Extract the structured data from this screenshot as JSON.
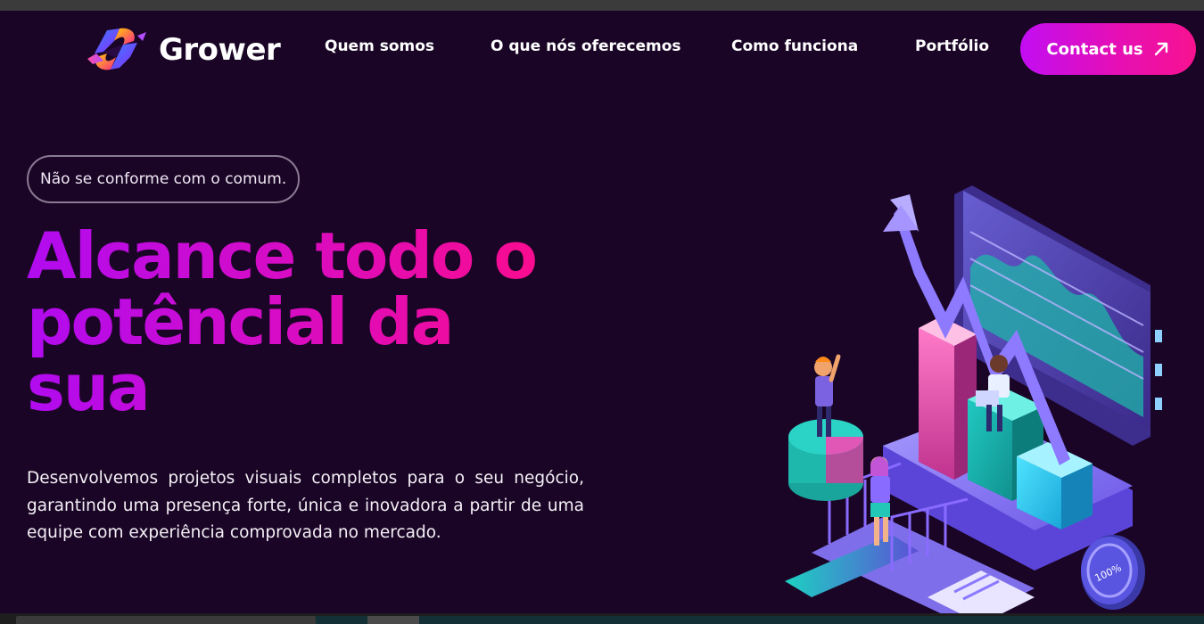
{
  "brand": {
    "name": "Grower",
    "logo_icon": "ribbon-s-logo-icon",
    "colors": {
      "background": "#1a0526",
      "accent_start": "#c20df2",
      "accent_end": "#f81290"
    }
  },
  "nav": {
    "items": [
      {
        "label": "Quem somos"
      },
      {
        "label": "O que nós oferecemos"
      },
      {
        "label": "Como funciona"
      },
      {
        "label": "Portfólio"
      }
    ],
    "cta": {
      "label": "Contact us",
      "icon": "arrow-up-right-icon"
    }
  },
  "hero": {
    "tagline": "Não se conforme com o comum.",
    "headline": "Alcance todo o potêncial da sua",
    "description": "Desenvolvemos projetos visuais completos para o seu negócio, garantindo uma presença forte, única e inovadora a partir de uma equipe com experiência comprovada no mercado.",
    "illustration": {
      "icon": "isometric-growth-chart-illustration",
      "badge_text": "100%"
    }
  }
}
